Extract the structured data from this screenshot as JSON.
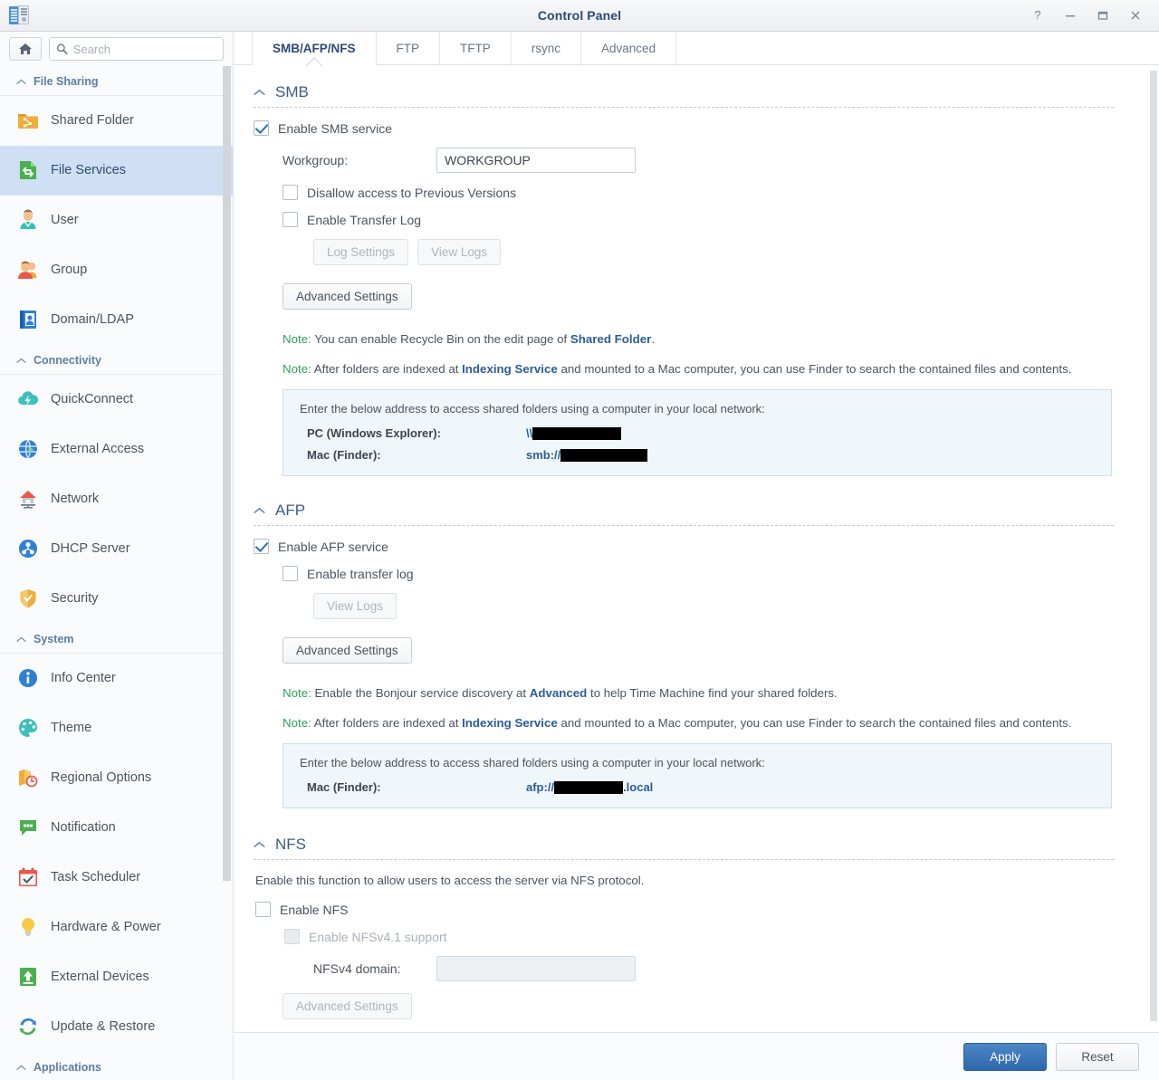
{
  "window": {
    "title": "Control Panel",
    "controls": [
      {
        "name": "help-button",
        "glyph": "?"
      },
      {
        "name": "minimize-button",
        "glyph": "–"
      },
      {
        "name": "maximize-button",
        "glyph": "□"
      },
      {
        "name": "close-button",
        "glyph": "✕"
      }
    ]
  },
  "sidebar": {
    "home_tooltip": "Home",
    "search": {
      "value": "",
      "placeholder": "Search"
    },
    "groups": [
      {
        "label": "File Sharing",
        "items": [
          {
            "label": "Shared Folder",
            "icon": "shared-folder-icon",
            "active": false
          },
          {
            "label": "File Services",
            "icon": "file-services-icon",
            "active": true
          },
          {
            "label": "User",
            "icon": "user-icon",
            "active": false
          },
          {
            "label": "Group",
            "icon": "group-icon",
            "active": false
          },
          {
            "label": "Domain/LDAP",
            "icon": "domain-ldap-icon",
            "active": false
          }
        ]
      },
      {
        "label": "Connectivity",
        "items": [
          {
            "label": "QuickConnect",
            "icon": "quickconnect-icon",
            "active": false
          },
          {
            "label": "External Access",
            "icon": "external-access-icon",
            "active": false
          },
          {
            "label": "Network",
            "icon": "network-icon",
            "active": false
          },
          {
            "label": "DHCP Server",
            "icon": "dhcp-server-icon",
            "active": false
          },
          {
            "label": "Security",
            "icon": "security-icon",
            "active": false
          }
        ]
      },
      {
        "label": "System",
        "items": [
          {
            "label": "Info Center",
            "icon": "info-center-icon",
            "active": false
          },
          {
            "label": "Theme",
            "icon": "theme-icon",
            "active": false
          },
          {
            "label": "Regional Options",
            "icon": "regional-options-icon",
            "active": false
          },
          {
            "label": "Notification",
            "icon": "notification-icon",
            "active": false
          },
          {
            "label": "Task Scheduler",
            "icon": "task-scheduler-icon",
            "active": false
          },
          {
            "label": "Hardware & Power",
            "icon": "hardware-power-icon",
            "active": false
          },
          {
            "label": "External Devices",
            "icon": "external-devices-icon",
            "active": false
          },
          {
            "label": "Update & Restore",
            "icon": "update-restore-icon",
            "active": false
          }
        ]
      },
      {
        "label": "Applications",
        "items": []
      }
    ]
  },
  "tabs": [
    {
      "label": "SMB/AFP/NFS",
      "active": true
    },
    {
      "label": "FTP",
      "active": false
    },
    {
      "label": "TFTP",
      "active": false
    },
    {
      "label": "rsync",
      "active": false
    },
    {
      "label": "Advanced",
      "active": false
    }
  ],
  "smb": {
    "section_title": "SMB",
    "enable_label": "Enable SMB service",
    "enable_checked": true,
    "workgroup_label": "Workgroup:",
    "workgroup_value": "WORKGROUP",
    "disallow_label": "Disallow access to Previous Versions",
    "disallow_checked": false,
    "transfer_log_label": "Enable Transfer Log",
    "transfer_log_checked": false,
    "log_settings_button": "Log Settings",
    "view_logs_button": "View Logs",
    "advanced_settings_button": "Advanced Settings",
    "note1_lead": "Note:",
    "note1_a": " You can enable Recycle Bin on the edit page of ",
    "note1_link": "Shared Folder",
    "note1_b": ".",
    "note2_lead": "Note:",
    "note2_a": " After folders are indexed at ",
    "note2_link": "Indexing Service",
    "note2_b": " and mounted to a Mac computer, you can use Finder to search the contained files and contents.",
    "info_intro": "Enter the below address to access shared folders using a computer in your local network:",
    "pc_key": "PC (Windows Explorer):",
    "pc_prefix": "\\\\",
    "mac_key": "Mac (Finder):",
    "mac_prefix": "smb://"
  },
  "afp": {
    "section_title": "AFP",
    "enable_label": "Enable AFP service",
    "enable_checked": true,
    "transfer_log_label": "Enable transfer log",
    "transfer_log_checked": false,
    "view_logs_button": "View Logs",
    "advanced_settings_button": "Advanced Settings",
    "note1_lead": "Note:",
    "note1_a": " Enable the Bonjour service discovery at ",
    "note1_link": "Advanced",
    "note1_b": " to help Time Machine find your shared folders.",
    "note2_lead": "Note:",
    "note2_a": " After folders are indexed at ",
    "note2_link": "Indexing Service",
    "note2_b": " and mounted to a Mac computer, you can use Finder to search the contained files and contents.",
    "info_intro": "Enter the below address to access shared folders using a computer in your local network:",
    "mac_key": "Mac (Finder):",
    "mac_prefix": "afp://",
    "mac_suffix": ".local"
  },
  "nfs": {
    "section_title": "NFS",
    "description": "Enable this function to allow users to access the server via NFS protocol.",
    "enable_label": "Enable NFS",
    "enable_checked": false,
    "nfsv41_label": "Enable NFSv4.1 support",
    "nfsv41_checked": false,
    "nfsv41_disabled": true,
    "domain_label": "NFSv4 domain:",
    "domain_value": "",
    "advanced_settings_button": "Advanced Settings"
  },
  "footer": {
    "apply_label": "Apply",
    "reset_label": "Reset"
  },
  "colors": {
    "accent": "#2c4a72",
    "primary_button": "#2f69ad",
    "active_sidebar": "#cfe0f4",
    "note_lead": "#2f9e5e",
    "link": "#2c5c99",
    "infobox_bg": "#f0f7fb"
  }
}
